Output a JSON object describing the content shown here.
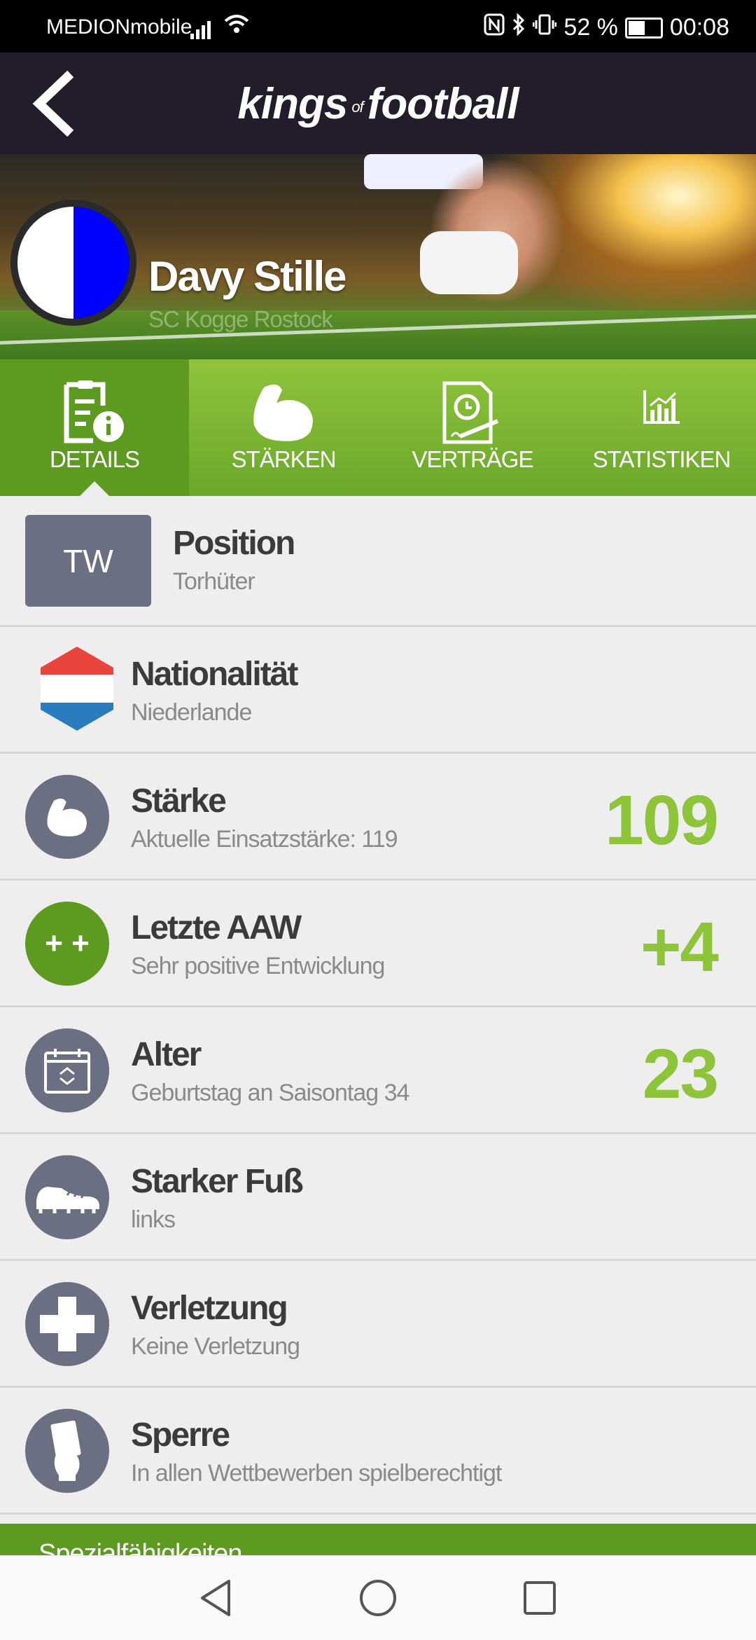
{
  "status_bar": {
    "carrier": "MEDIONmobile",
    "battery": "52 %",
    "battery_level": 0.52,
    "time": "00:08",
    "icons": [
      "signal-icon",
      "wifi-icon",
      "nfc-icon",
      "bluetooth-icon",
      "vibrate-icon",
      "battery-icon"
    ]
  },
  "header": {
    "logo_main_1": "kings",
    "logo_of": "of",
    "logo_main_2": "football",
    "back_icon": "chevron-left-icon"
  },
  "player": {
    "name": "Davy Stille",
    "club": "SC Kogge Rostock",
    "crest_colors": [
      "#ffffff",
      "#0000ff"
    ]
  },
  "tabs": [
    {
      "label": "DETAILS",
      "icon": "details-document-icon",
      "active": true
    },
    {
      "label": "STÄRKEN",
      "icon": "flexed-arm-icon",
      "active": false
    },
    {
      "label": "VERTRÄGE",
      "icon": "contract-clock-icon",
      "active": false
    },
    {
      "label": "STATISTIKEN",
      "icon": "chart-icon",
      "active": false
    }
  ],
  "details": {
    "position": {
      "badge": "TW",
      "title": "Position",
      "sub": "Torhüter"
    },
    "nationality": {
      "title": "Nationalität",
      "sub": "Niederlande",
      "flag_colors": [
        "#e8453c",
        "#ffffff",
        "#2b7bbf"
      ]
    },
    "strength": {
      "title": "Stärke",
      "sub": "Aktuelle Einsatzstärke: 119",
      "value": "109",
      "icon": "flexed-arm-icon"
    },
    "last_aaw": {
      "title": "Letzte AAW",
      "sub": "Sehr positive Entwicklung",
      "value": "+4",
      "icon_text": "+ +"
    },
    "age": {
      "title": "Alter",
      "sub": "Geburtstag an Saisontag 34",
      "value": "23",
      "icon": "calendar-icon"
    },
    "foot": {
      "title": "Starker Fuß",
      "sub": "links",
      "icon": "football-boot-icon"
    },
    "injury": {
      "title": "Verletzung",
      "sub": "Keine Verletzung",
      "icon": "medical-cross-icon"
    },
    "suspension": {
      "title": "Sperre",
      "sub": "In allen Wettbewerben spielberechtigt",
      "icon": "card-hand-icon"
    }
  },
  "special_section": {
    "label": "Spezialfähigkeiten"
  },
  "colors": {
    "accent_green": "#8ec43a",
    "dark_green": "#5d9a20",
    "header_bg": "#231c2b",
    "icon_gray": "#6a7081"
  },
  "nav": {
    "icons": [
      "back-triangle-icon",
      "home-circle-icon",
      "recents-square-icon"
    ]
  }
}
